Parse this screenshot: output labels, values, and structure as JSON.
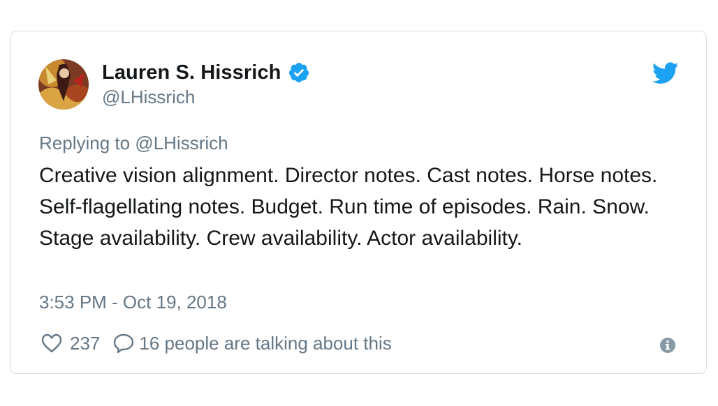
{
  "tweet": {
    "author": {
      "display_name": "Lauren S. Hissrich",
      "handle": "@LHissrich",
      "verified": true,
      "avatar_icon": "profile-photo"
    },
    "reply_to": "Replying to @LHissrich",
    "text": "Creative vision alignment. Director notes. Cast notes. Horse notes. Self-flagellating notes. Budget. Run time of episodes. Rain. Snow. Stage availability. Crew availability. Actor availability.",
    "timestamp": "3:53 PM - Oct 19, 2018",
    "actions": {
      "like_icon": "heart-icon",
      "like_count": "237",
      "reply_icon": "speech-bubble-icon",
      "talking_text": "16 people are talking about this",
      "info_icon": "info-icon"
    },
    "brand_icon": "twitter-bird-icon"
  },
  "colors": {
    "brand_blue": "#1da1f2",
    "text_primary": "#14171a",
    "text_secondary": "#657786",
    "border": "#d9dde1"
  }
}
